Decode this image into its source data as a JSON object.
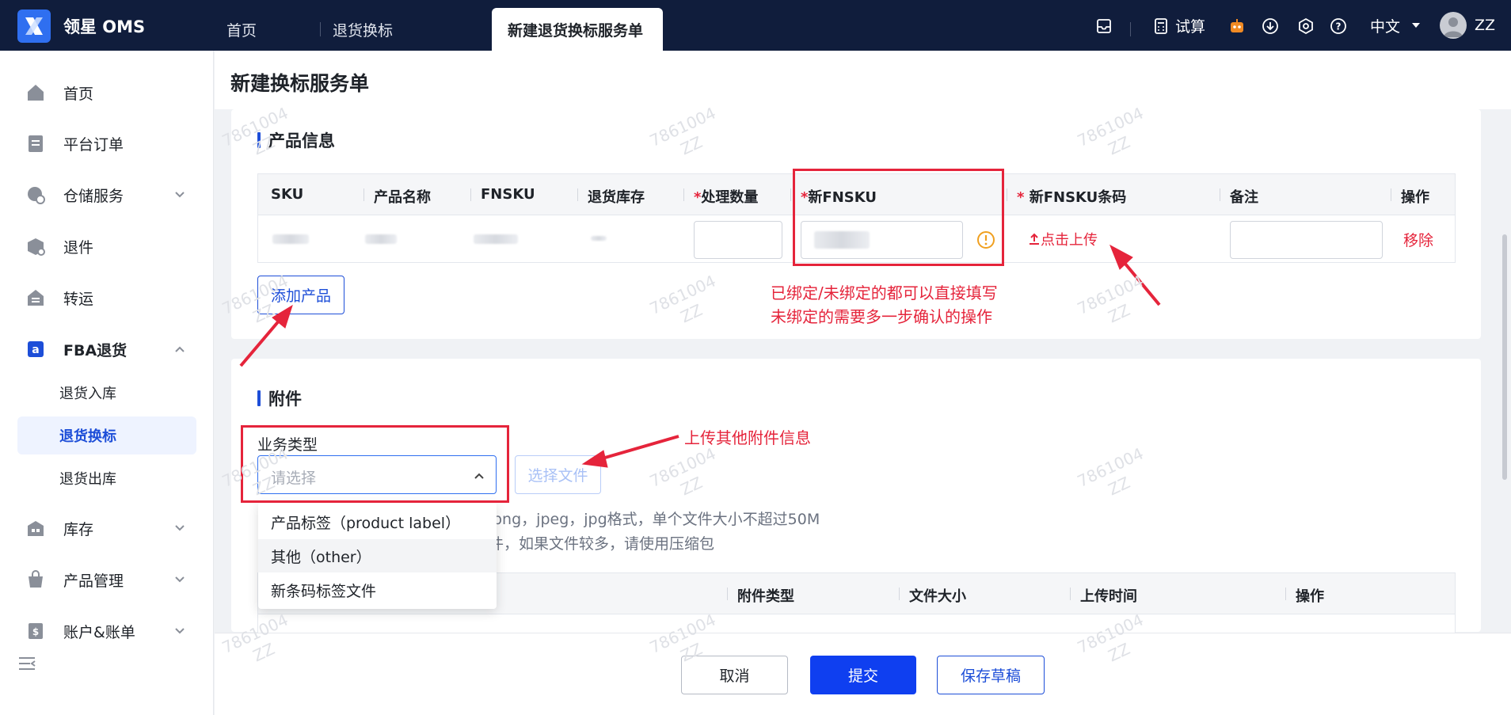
{
  "app": {
    "name": "领星 OMS"
  },
  "tabs": [
    {
      "label": "首页"
    },
    {
      "label": "退货换标"
    },
    {
      "label": "新建退货换标服务单"
    }
  ],
  "topbar": {
    "trial_label": "试算",
    "language": "中文",
    "user": "ZZ"
  },
  "sidebar": {
    "items": [
      {
        "label": "首页",
        "icon": "home-icon"
      },
      {
        "label": "平台订单",
        "icon": "clipboard-icon"
      },
      {
        "label": "仓储服务",
        "icon": "warehouse-icon"
      },
      {
        "label": "退件",
        "icon": "return-box-icon"
      },
      {
        "label": "转运",
        "icon": "transfer-icon"
      },
      {
        "label": "FBA退货",
        "icon": "amazon-icon"
      },
      {
        "label": "库存",
        "icon": "inventory-icon"
      },
      {
        "label": "产品管理",
        "icon": "bag-icon"
      },
      {
        "label": "账户&账单",
        "icon": "bill-icon"
      }
    ],
    "sub_items": [
      {
        "label": "退货入库"
      },
      {
        "label": "退货换标"
      },
      {
        "label": "退货出库"
      }
    ]
  },
  "page": {
    "title": "新建换标服务单"
  },
  "product_section": {
    "title": "产品信息",
    "columns": [
      "SKU",
      "产品名称",
      "FNSKU",
      "退货库存",
      "处理数量",
      "新FNSKU",
      "新FNSKU条码",
      "备注",
      "操作"
    ],
    "required_mark": "*",
    "upload_link": "点击上传",
    "remove_link": "移除",
    "add_button": "添加产品"
  },
  "attachment_section": {
    "title": "附件",
    "business_type_label": "业务类型",
    "select_placeholder": "请选择",
    "choose_file_button": "选择文件",
    "hint_1": "png，jpeg，jpg格式，单个文件大小不超过50M",
    "hint_2": "件，如果文件较多，请使用压缩包",
    "columns": [
      "附件类型",
      "文件大小",
      "上传时间",
      "操作"
    ],
    "dropdown_options": [
      "产品标签（product label）",
      "其他（other）",
      "新条码标签文件"
    ]
  },
  "annotations": {
    "note_1": "已绑定/未绑定的都可以直接填写",
    "note_2": "未绑定的需要多一步确认的操作",
    "note_3": "上传其他附件信息"
  },
  "footer": {
    "cancel": "取消",
    "submit": "提交",
    "save_draft": "保存草稿"
  },
  "watermark": {
    "line1": "7861004",
    "line2": "ZZ"
  },
  "colors": {
    "topbar": "#101d3c",
    "primary": "#0f3ff0",
    "annotation_red": "#e5243b"
  }
}
